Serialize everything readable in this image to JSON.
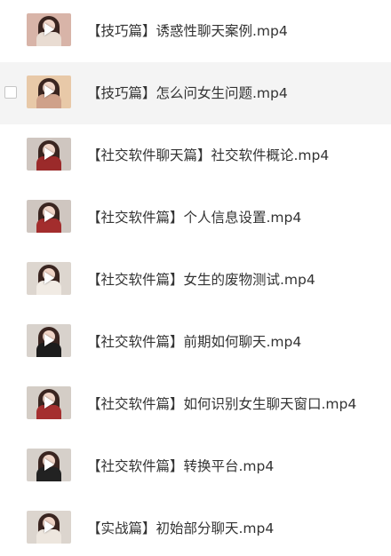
{
  "files": [
    {
      "name": "【技巧篇】诱惑性聊天案例.mp4",
      "hover": false,
      "thumb_bg": "#d8b4a8",
      "thumb_body": "#e9dcd2"
    },
    {
      "name": "【技巧篇】怎么问女生问题.mp4",
      "hover": true,
      "thumb_bg": "#e8c9a8",
      "thumb_body": "#cfa18a"
    },
    {
      "name": "【社交软件聊天篇】社交软件概论.mp4",
      "hover": false,
      "thumb_bg": "#cfc6c0",
      "thumb_body": "#9b2a2a"
    },
    {
      "name": "【社交软件篇】个人信息设置.mp4",
      "hover": false,
      "thumb_bg": "#cfc6c0",
      "thumb_body": "#a32d2d"
    },
    {
      "name": "【社交软件篇】女生的废物测试.mp4",
      "hover": false,
      "thumb_bg": "#ddd6cf",
      "thumb_body": "#f1ebe4"
    },
    {
      "name": "【社交软件篇】前期如何聊天.mp4",
      "hover": false,
      "thumb_bg": "#d8d2cc",
      "thumb_body": "#1c1c1c"
    },
    {
      "name": "【社交软件篇】如何识别女生聊天窗口.mp4",
      "hover": false,
      "thumb_bg": "#d4cdc6",
      "thumb_body": "#a52f2f"
    },
    {
      "name": "【社交软件篇】转换平台.mp4",
      "hover": false,
      "thumb_bg": "#d6d0ca",
      "thumb_body": "#222222"
    },
    {
      "name": "【实战篇】初始部分聊天.mp4",
      "hover": false,
      "thumb_bg": "#dcd5ce",
      "thumb_body": "#ede6de"
    }
  ]
}
